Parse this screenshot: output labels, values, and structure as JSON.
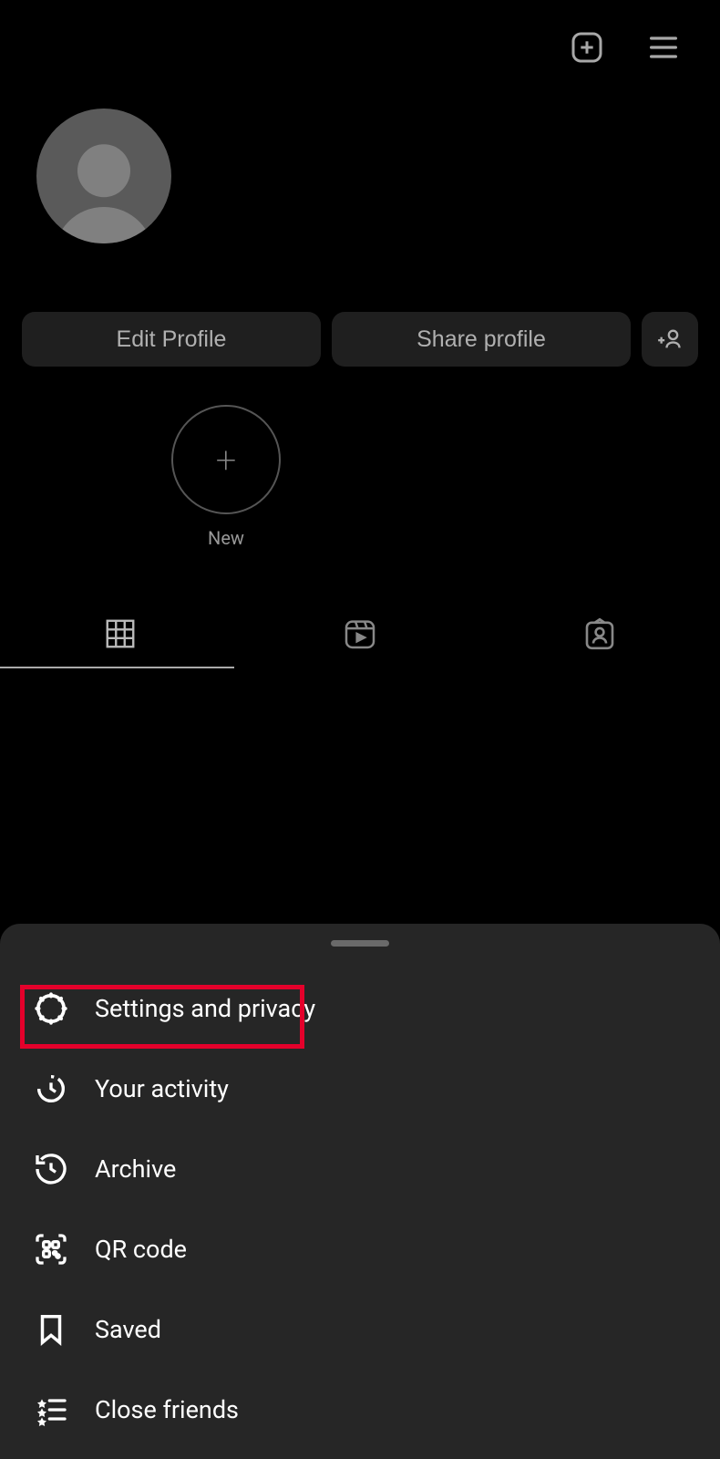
{
  "buttons": {
    "edit_profile": "Edit Profile",
    "share_profile": "Share profile"
  },
  "highlights": {
    "new_label": "New"
  },
  "menu": {
    "settings": "Settings and privacy",
    "activity": "Your activity",
    "archive": "Archive",
    "qrcode": "QR code",
    "saved": "Saved",
    "close_friends": "Close friends"
  }
}
